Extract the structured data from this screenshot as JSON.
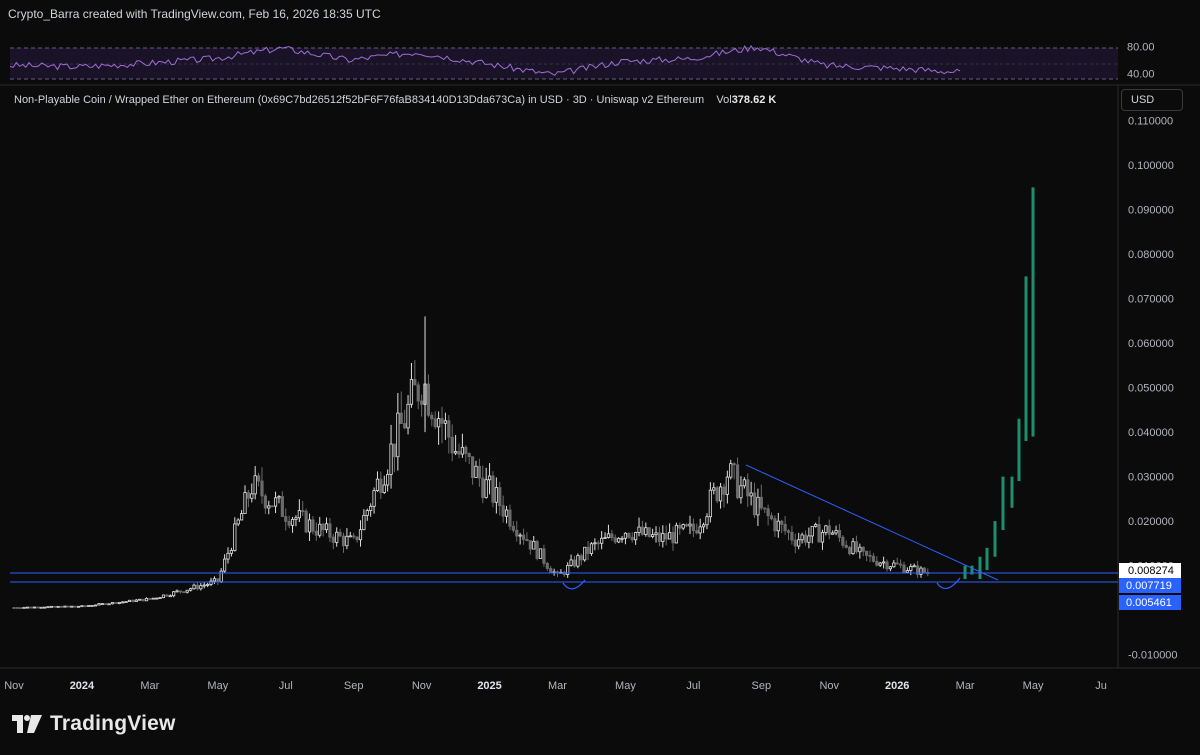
{
  "header": {
    "text": "Crypto_Barra created with TradingView.com, Feb 16, 2026 18:35 UTC"
  },
  "legend": {
    "pair": "Non-Playable Coin / Wrapped Ether on Ethereum (0x69C7bd26512f52bF6F76faB834140D13Dda673Ca) in USD · 3D · Uniswap v2 Ethereum",
    "vol_label": "Vol",
    "vol_value": "378.62 K"
  },
  "currency_button": "USD",
  "branding": {
    "wordmark": "TradingView"
  },
  "colors": {
    "background": "#0b0b0b",
    "candle_up": "#e0e0e0",
    "candle_down": "#6b6b6b",
    "projection": "#1e8f6e",
    "lines": "#2962ff",
    "rsi": "#9d6fd6"
  },
  "chart_data": [
    {
      "type": "line",
      "title": "RSI",
      "y_ticks": [
        "80.00",
        "40.00"
      ],
      "ylim": [
        30,
        90
      ],
      "bands": [
        70,
        30
      ],
      "x": [
        "Nov 2023",
        "Jan 2024",
        "Mar 2024",
        "May 2024",
        "Jul 2024",
        "Sep 2024",
        "Nov 2024",
        "Jan 2025",
        "Mar 2025",
        "May 2025",
        "Jul 2025",
        "Sep 2025",
        "Nov 2025",
        "Jan 2026",
        "Feb 2026"
      ],
      "values": [
        52,
        50,
        55,
        62,
        78,
        60,
        72,
        55,
        38,
        58,
        62,
        80,
        52,
        48,
        42
      ]
    },
    {
      "type": "candlestick",
      "y_ticks": [
        "0.110000",
        "0.100000",
        "0.090000",
        "0.080000",
        "0.070000",
        "0.060000",
        "0.050000",
        "0.040000",
        "0.030000",
        "0.020000",
        "0.010000",
        "-0.010000"
      ],
      "ylim": [
        -0.013,
        0.118
      ],
      "x_ticks": [
        "Nov",
        "2024",
        "Mar",
        "May",
        "Jul",
        "Sep",
        "Nov",
        "2025",
        "Mar",
        "May",
        "Jul",
        "Sep",
        "Nov",
        "2026",
        "Mar",
        "May",
        "Ju"
      ],
      "series": [
        {
          "name": "",
          "points": [
            {
              "date": "2023-11",
              "close": 0.0006
            },
            {
              "date": "2024-01",
              "close": 0.0009
            },
            {
              "date": "2024-03",
              "close": 0.0025
            },
            {
              "date": "2024-05",
              "close": 0.0065
            },
            {
              "date": "2024-06",
              "close": 0.028
            },
            {
              "date": "2024-07",
              "close": 0.022
            },
            {
              "date": "2024-08",
              "close": 0.018
            },
            {
              "date": "2024-09",
              "close": 0.015
            },
            {
              "date": "2024-10",
              "close": 0.034
            },
            {
              "date": "2024-11",
              "close": 0.052
            },
            {
              "date": "2024-12",
              "close": 0.036
            },
            {
              "date": "2025-01",
              "close": 0.027
            },
            {
              "date": "2025-02",
              "close": 0.017
            },
            {
              "date": "2025-03",
              "close": 0.0075
            },
            {
              "date": "2025-04",
              "close": 0.014
            },
            {
              "date": "2025-05",
              "close": 0.018
            },
            {
              "date": "2025-06",
              "close": 0.016
            },
            {
              "date": "2025-07",
              "close": 0.018
            },
            {
              "date": "2025-08",
              "close": 0.031
            },
            {
              "date": "2025-09",
              "close": 0.022
            },
            {
              "date": "2025-10",
              "close": 0.016
            },
            {
              "date": "2025-11",
              "close": 0.018
            },
            {
              "date": "2025-12",
              "close": 0.012
            },
            {
              "date": "2026-01",
              "close": 0.01
            },
            {
              "date": "2026-02",
              "close": 0.0082
            }
          ]
        },
        {
          "name": "",
          "points": [
            {
              "date": "2026-02",
              "close": 0.009
            },
            {
              "date": "2026-03",
              "close": 0.012
            },
            {
              "date": "2026-03",
              "close": 0.02
            },
            {
              "date": "2026-04",
              "close": 0.03
            },
            {
              "date": "2026-04",
              "close": 0.043
            },
            {
              "date": "2026-04",
              "close": 0.075
            },
            {
              "date": "2026-05",
              "close": 0.095
            }
          ]
        }
      ],
      "price_labels": [
        "0.008274",
        "0.007719",
        "0.005461"
      ],
      "horizontal_lines": [
        0.0082,
        0.0055
      ],
      "trendline": [
        {
          "date": "2025-08",
          "price": 0.0335
        },
        {
          "date": "2026-03",
          "price": 0.0045
        }
      ]
    }
  ]
}
